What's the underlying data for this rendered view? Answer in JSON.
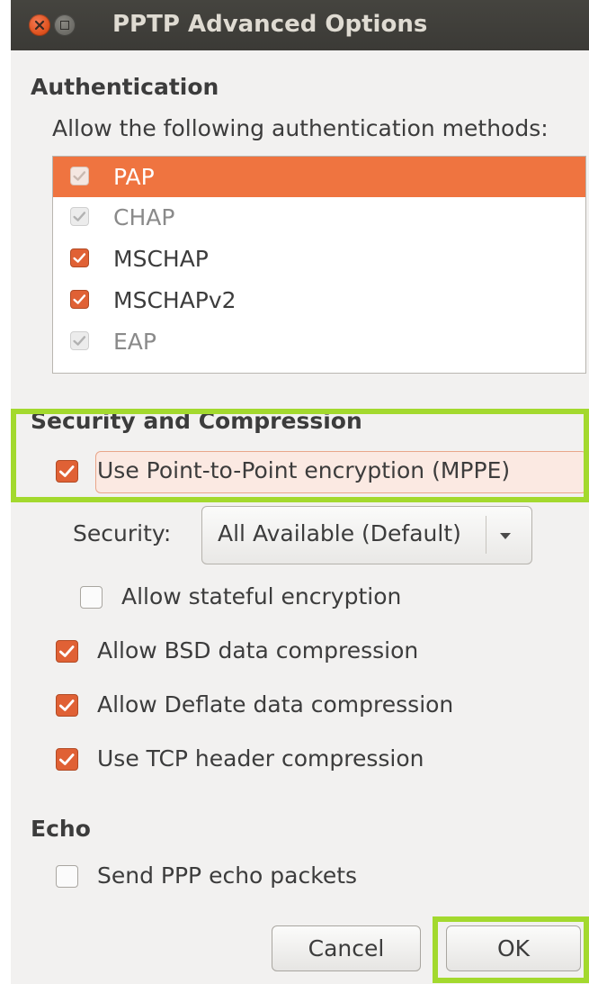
{
  "window": {
    "title": "PPTP Advanced Options"
  },
  "authentication": {
    "title": "Authentication",
    "prompt": "Allow the following authentication methods:",
    "methods": [
      {
        "label": "PAP",
        "checked": true,
        "selected": true
      },
      {
        "label": "CHAP",
        "checked": true,
        "selected": false
      },
      {
        "label": "MSCHAP",
        "checked": true,
        "selected": false
      },
      {
        "label": "MSCHAPv2",
        "checked": true,
        "selected": false
      },
      {
        "label": "EAP",
        "checked": true,
        "selected": false
      }
    ]
  },
  "security": {
    "title": "Security and Compression",
    "mppe_label": "Use Point-to-Point encryption (MPPE)",
    "mppe_checked": true,
    "security_label": "Security:",
    "security_value": "All Available (Default)",
    "stateful_label": "Allow stateful encryption",
    "stateful_checked": false,
    "bsd_label": "Allow BSD data compression",
    "bsd_checked": true,
    "deflate_label": "Allow Deflate data compression",
    "deflate_checked": true,
    "tcp_label": "Use TCP header compression",
    "tcp_checked": true
  },
  "echo": {
    "title": "Echo",
    "send_label": "Send PPP echo packets",
    "send_checked": false
  },
  "buttons": {
    "cancel": "Cancel",
    "ok": "OK"
  },
  "colors": {
    "accent": "#ef7440",
    "checkbox": "#e06135",
    "annotation": "#a3d92e",
    "titlebar": "#3c3b37"
  }
}
